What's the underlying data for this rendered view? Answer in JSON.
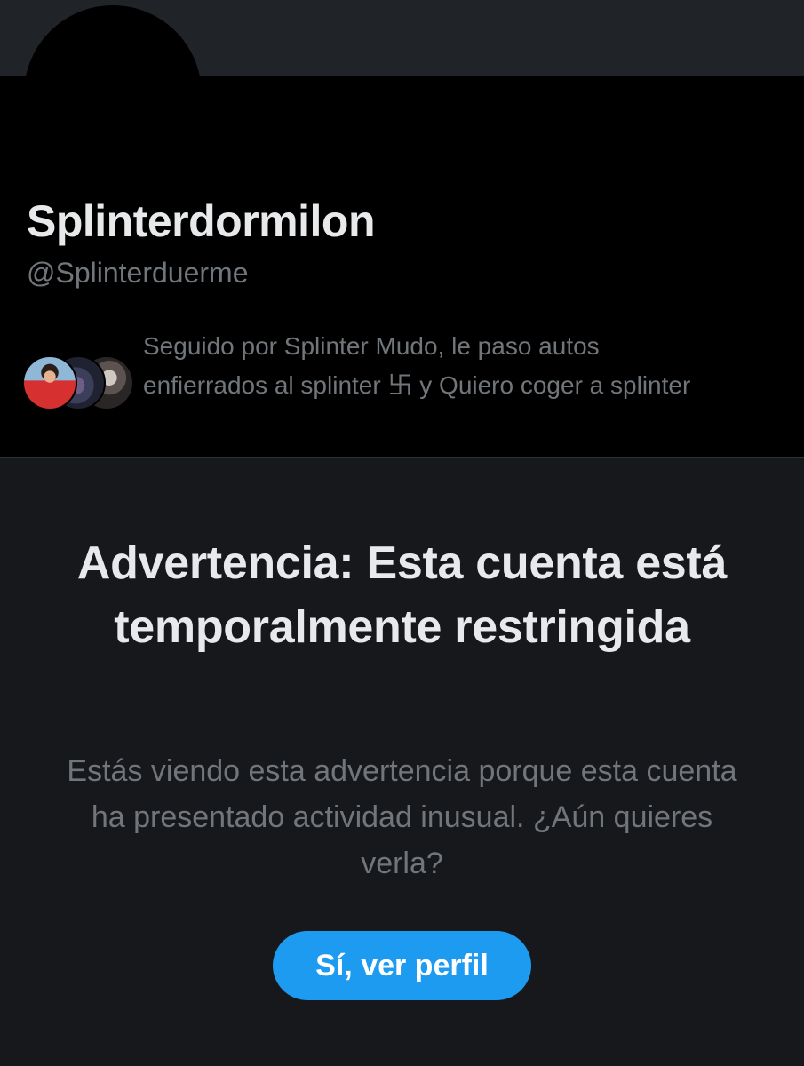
{
  "profile": {
    "display_name": "Splinterdormilon",
    "handle": "@Splinterduerme",
    "followed_by": "Seguido por Splinter Mudo, le paso autos enfierrados al splinter 卐 y Quiero coger a splinter"
  },
  "warning": {
    "title": "Advertencia: Esta cuenta está temporalmente restringida",
    "body": "Estás viendo esta advertencia porque esta cuenta ha presentado actividad inusual. ¿Aún quieres verla?",
    "button_label": "Sí, ver perfil"
  },
  "colors": {
    "background": "#16181c",
    "banner": "#202327",
    "profile_background": "#000000",
    "primary_text": "#e7e9ea",
    "secondary_text": "#71767b",
    "accent": "#1d9bf0"
  }
}
